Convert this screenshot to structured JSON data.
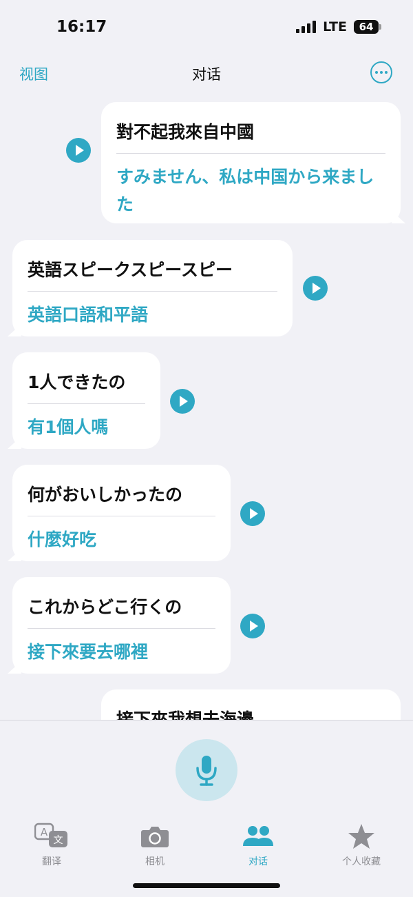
{
  "status": {
    "time": "16:17",
    "network": "LTE",
    "battery": "64"
  },
  "nav": {
    "left": "视图",
    "title": "对话"
  },
  "messages": [
    {
      "source": "對不起我來自中國",
      "translation": "すみません、私は中国から来ました"
    },
    {
      "source": "英語スピークスピースピー",
      "translation": "英語口語和平語"
    },
    {
      "source": "1人できたの",
      "translation": "有1個人嗎"
    },
    {
      "source": "何がおいしかったの",
      "translation": "什麼好吃"
    },
    {
      "source": "これからどこ行くの",
      "translation": "接下來要去哪裡"
    },
    {
      "source": "接下來我想去海邊",
      "translation": ""
    }
  ],
  "tabs": [
    {
      "label": "翻译",
      "icon": "translate-icon"
    },
    {
      "label": "相机",
      "icon": "camera-icon"
    },
    {
      "label": "对话",
      "icon": "people-icon"
    },
    {
      "label": "个人收藏",
      "icon": "star-icon"
    }
  ],
  "active_tab": "对话",
  "colors": {
    "accent": "#2fa8c4",
    "background": "#f1f1f6",
    "mic_bg": "#cbe6ee"
  }
}
